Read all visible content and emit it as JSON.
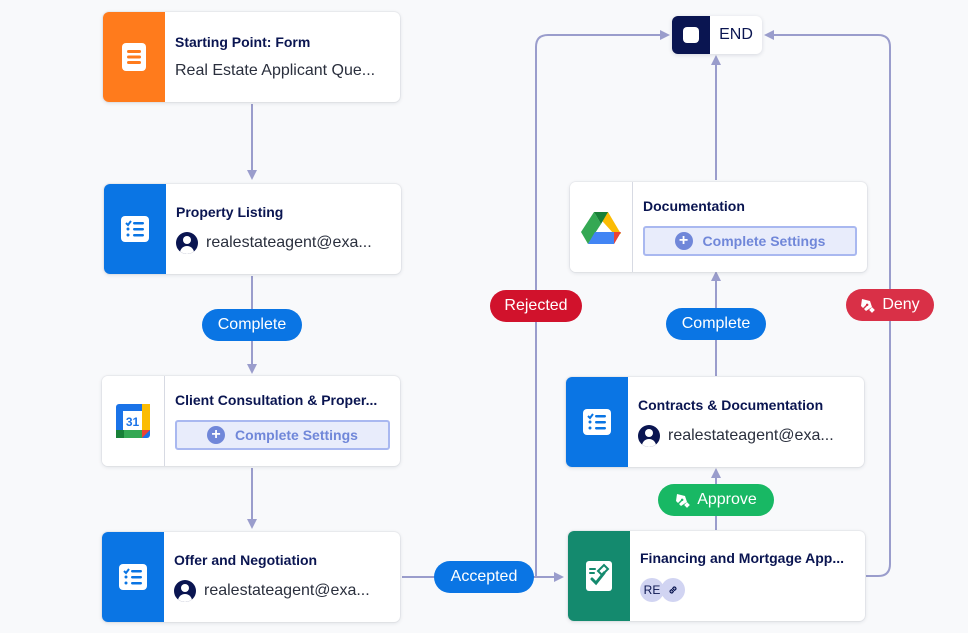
{
  "colors": {
    "form_orange": "#ff7b1c",
    "approval_blue": "#0a75e4",
    "sign_green": "#148a6e",
    "navy": "#0a1551",
    "wire": "#9a9dcc",
    "complete_pill": "#0a75e4",
    "rejected_pill": "#d1122c",
    "deny_pill": "#d93047",
    "approve_pill": "#18b864"
  },
  "nodes": {
    "start": {
      "title": "Starting Point: Form",
      "subtitle": "Real Estate Applicant Que...",
      "icon": "form-icon"
    },
    "property_listing": {
      "title": "Property Listing",
      "assignee": "realestateagent@exa...",
      "icon": "task-list-icon"
    },
    "client_consultation": {
      "title": "Client Consultation & Proper...",
      "button": "Complete Settings",
      "icon": "google-calendar-icon",
      "calendar_day": "31"
    },
    "offer_negotiation": {
      "title": "Offer and Negotiation",
      "assignee": "realestateagent@exa...",
      "icon": "task-list-icon"
    },
    "financing": {
      "title": "Financing and Mortgage App...",
      "tag_initials": "RE",
      "icon": "sign-document-icon"
    },
    "contracts": {
      "title": "Contracts & Documentation",
      "assignee": "realestateagent@exa...",
      "icon": "task-list-icon"
    },
    "documentation": {
      "title": "Documentation",
      "button": "Complete Settings",
      "icon": "google-drive-icon"
    },
    "end": {
      "label": "END"
    }
  },
  "edges": {
    "complete_1": "Complete",
    "accepted": "Accepted",
    "rejected": "Rejected",
    "approve": "Approve",
    "complete_2": "Complete",
    "deny": "Deny"
  }
}
